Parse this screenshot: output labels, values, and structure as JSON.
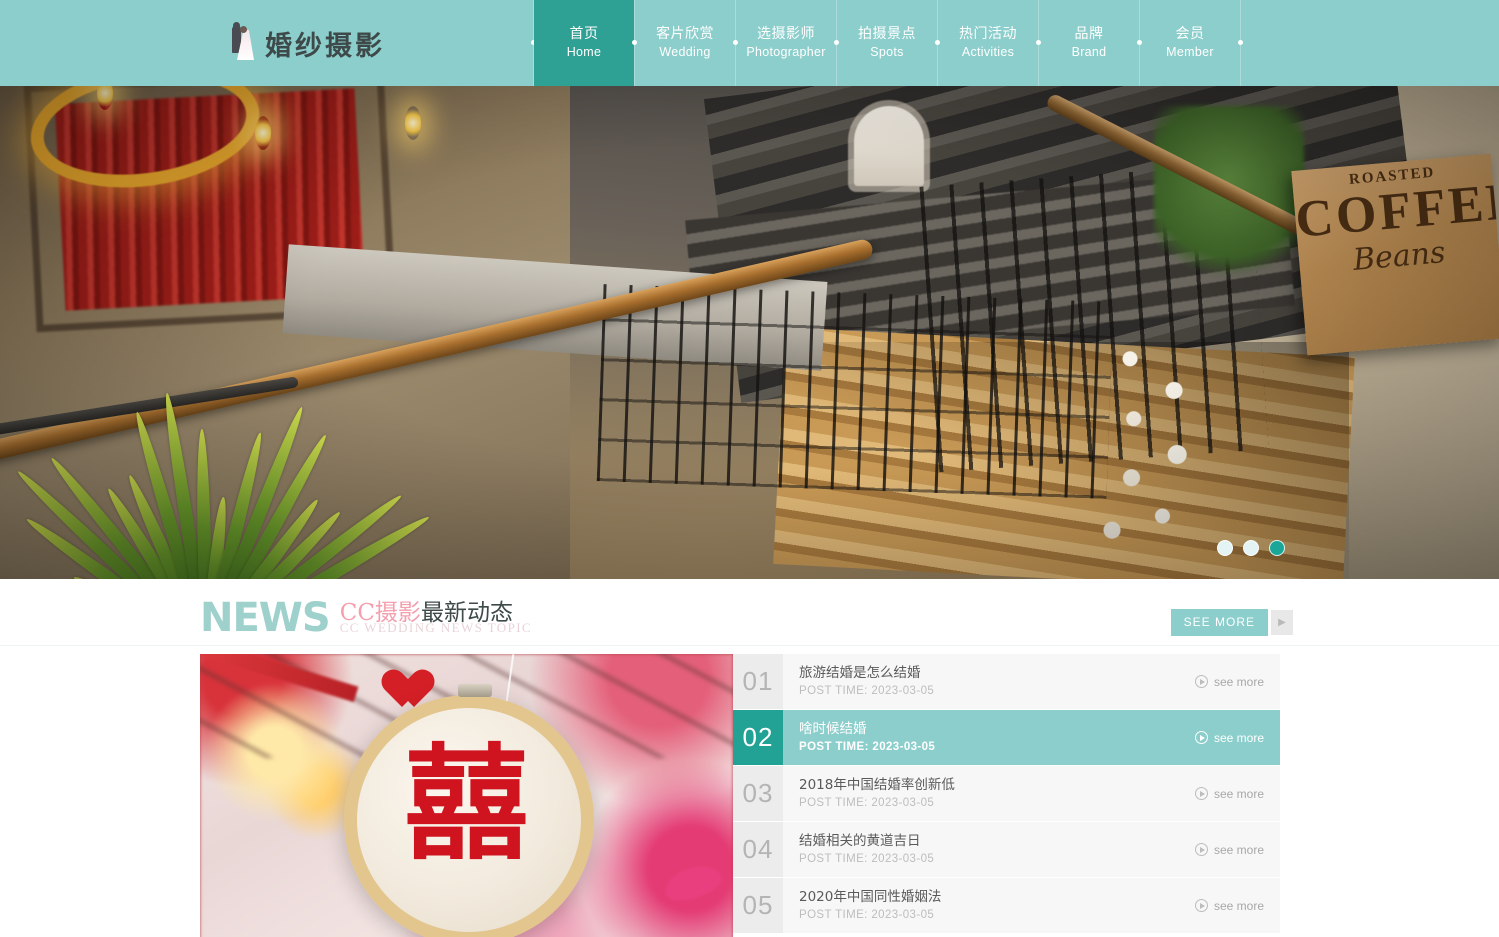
{
  "site": {
    "logo_text": "婚纱摄影",
    "logo_icon": "bride-groom-icon"
  },
  "nav": {
    "items": [
      {
        "cn": "首页",
        "en": "Home",
        "active": true
      },
      {
        "cn": "客片欣赏",
        "en": "Wedding",
        "active": false
      },
      {
        "cn": "选摄影师",
        "en": "Photographer",
        "active": false
      },
      {
        "cn": "拍摄景点",
        "en": "Spots",
        "active": false
      },
      {
        "cn": "热门活动",
        "en": "Activities",
        "active": false
      },
      {
        "cn": "品牌",
        "en": "Brand",
        "active": false
      },
      {
        "cn": "会员",
        "en": "Member",
        "active": false
      }
    ]
  },
  "hero": {
    "alt": "industrial-style interior with staircase, chandelier and palm plant",
    "sign": {
      "line1": "ROASTED",
      "line2": "COFFEE",
      "line3": "Beans"
    },
    "dots": [
      {
        "active": false
      },
      {
        "active": false
      },
      {
        "active": true
      }
    ]
  },
  "news": {
    "heading_en": "NEWS",
    "heading_cn_pink": "CC摄影",
    "heading_cn_dark": "最新动态",
    "heading_sub": "CC WEDDING NEWS TOPIC",
    "see_more_label": "SEE MORE",
    "see_more_arrow": "▶",
    "photo_alt": "double-happiness embroidery hoop",
    "photo_glyph": "囍",
    "see_more_link": "see more",
    "rows": [
      {
        "num": "01",
        "title": "旅游结婚是怎么结婚",
        "date": "POST TIME: 2023-03-05",
        "active": false
      },
      {
        "num": "02",
        "title": "啥时候结婚",
        "date": "POST TIME: 2023-03-05",
        "active": true
      },
      {
        "num": "03",
        "title": "2018年中国结婚率创新低",
        "date": "POST TIME: 2023-03-05",
        "active": false
      },
      {
        "num": "04",
        "title": "结婚相关的黄道吉日",
        "date": "POST TIME: 2023-03-05",
        "active": false
      },
      {
        "num": "05",
        "title": "2020年中国同性婚姻法",
        "date": "POST TIME: 2023-03-05",
        "active": false
      }
    ]
  },
  "colors": {
    "brand": "#8ccecb",
    "brand_active": "#2fa094",
    "accent_pink": "#f49fae",
    "row_bg": "#f7f7f7",
    "num_bg": "#ececec"
  }
}
